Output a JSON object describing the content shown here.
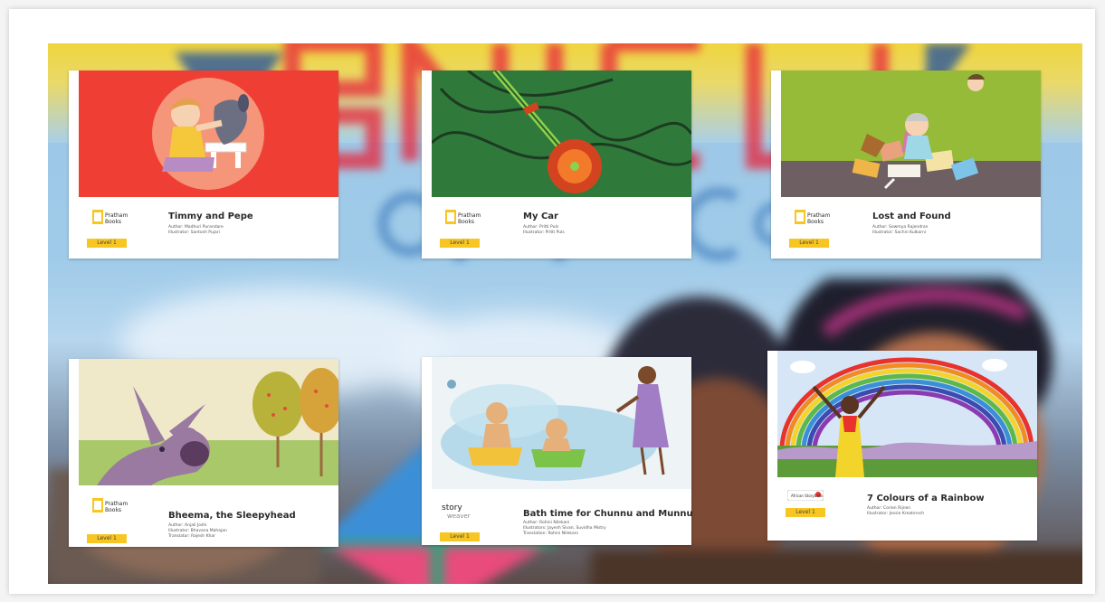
{
  "cards": [
    {
      "title": "Timmy and Pepe",
      "author": "Author: Madhuri Purandare",
      "illustrator": "Illustrator: Santosh Pujari",
      "translator": "",
      "level": "Level 1",
      "publisher": "Pratham Books",
      "tagline": ""
    },
    {
      "title": "My Car",
      "author": "Author: Pritti Puls",
      "illustrator": "Illustrator: Pritti Puls",
      "translator": "",
      "level": "Level 1",
      "publisher": "Pratham Books",
      "tagline": ""
    },
    {
      "title": "Lost and Found",
      "author": "Author: Sowmya Rajendran",
      "illustrator": "Illustrator: Sachin Kulkarni",
      "translator": "",
      "level": "Level 1",
      "publisher": "Pratham Books",
      "tagline": ""
    },
    {
      "title": "Bheema, the Sleepyhead",
      "author": "Author: Anjali Joshi",
      "illustrator": "Illustrator: Bhavana Mahajan",
      "translator": "Translator: Rajesh Khar",
      "level": "Level 1",
      "publisher": "Pratham Books",
      "tagline": ""
    },
    {
      "title": "Bath time for Chunnu and Munnu",
      "author": "Author: Rohini Nilekani",
      "illustrator": "Illustrators: Jayesh Sivan, Suvidha Mistry",
      "translator": "Translation: Rohini Nilekani",
      "level": "Level 1",
      "publisher": "story",
      "tagline": "weaver"
    },
    {
      "title": "7 Colours of a Rainbow",
      "author": "Author: Corien Rijnen",
      "illustrator": "Illustrator: Jessie Kreatersch",
      "translator": "",
      "level": "Level 1",
      "publisher": "African Storybook",
      "tagline": ""
    }
  ],
  "colors": {
    "level_badge": "#f7c623",
    "card_bg": "#ffffff",
    "timmy_bg": "#ef3f35",
    "car_bg": "#2f7a3a",
    "lost_bg": "#95bb38"
  }
}
